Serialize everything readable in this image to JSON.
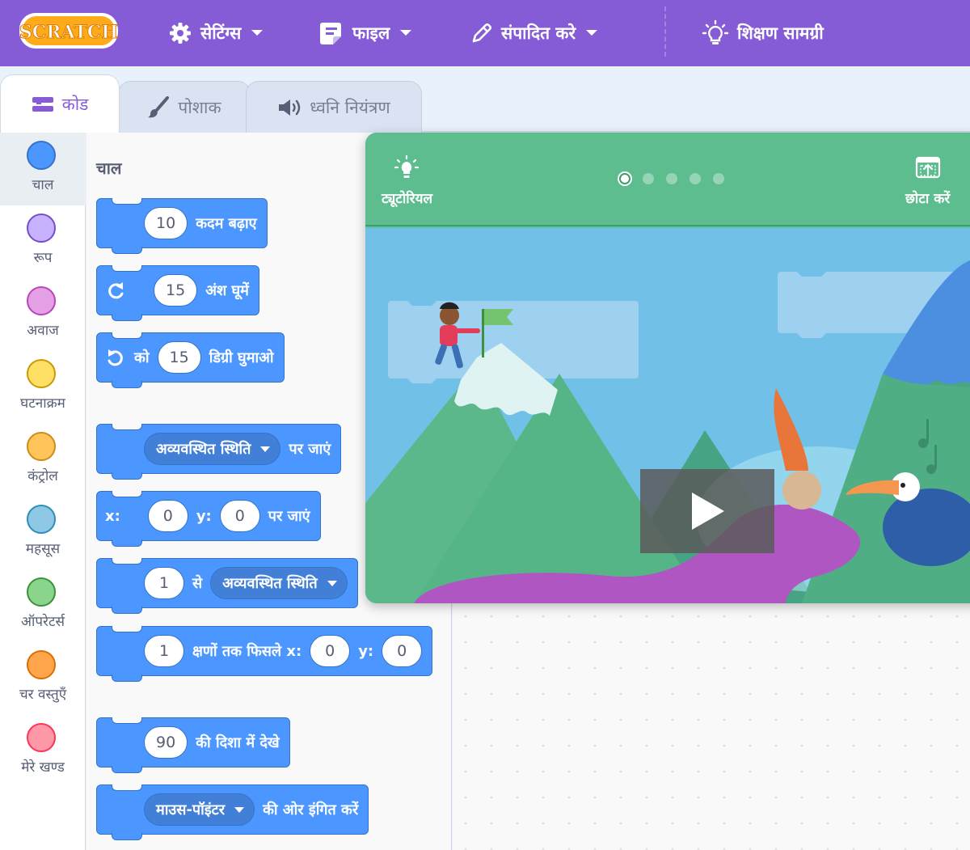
{
  "menubar": {
    "logo_text": "SCRATCH",
    "settings_label": "सेटिंग्स",
    "file_label": "फाइल",
    "edit_label": "संपादित करे",
    "tutorials_label": "शिक्षण सामग्री"
  },
  "tabs": [
    {
      "label": "कोड",
      "icon": "code-icon",
      "active": true
    },
    {
      "label": "पोशाक",
      "icon": "brush-icon",
      "active": false
    },
    {
      "label": "ध्वनि नियंत्रण",
      "icon": "speaker-icon",
      "active": false
    }
  ],
  "categories": [
    {
      "label": "चाल",
      "color": "#4c97ff",
      "border": "#3373cc",
      "selected": true
    },
    {
      "label": "रूप",
      "color": "#9966ff",
      "border": "#774dcb",
      "selected": false
    },
    {
      "label": "अवाज",
      "color": "#cf63cf",
      "border": "#bd42bd",
      "selected": false
    },
    {
      "label": "घटनाक्रम",
      "color": "#ffd500",
      "border": "#cc9900",
      "selected": false
    },
    {
      "label": "कंट्रोल",
      "color": "#ffab19",
      "border": "#cf8b17",
      "selected": false
    },
    {
      "label": "महसूस",
      "color": "#5cb1d6",
      "border": "#2e8eb8",
      "selected": false
    },
    {
      "label": "ऑपरेटर्स",
      "color": "#59c059",
      "border": "#389438",
      "selected": false
    },
    {
      "label": "चर वस्तुएँ",
      "color": "#ff8c1a",
      "border": "#db6e00",
      "selected": false
    },
    {
      "label": "मेरे खण्ड",
      "color": "#ff6680",
      "border": "#ff3355",
      "selected": false
    }
  ],
  "palette": {
    "heading": "चाल",
    "blocks": {
      "move": {
        "value": "10",
        "text": "कदम बढ़ाए"
      },
      "turn_right": {
        "value": "15",
        "text": "अंश घूमें"
      },
      "turn_left": {
        "prefix": "को",
        "value": "15",
        "text": "डिग्री घुमाओ"
      },
      "goto": {
        "dropdown": "अव्यवस्थित स्थिति",
        "text": "पर जाएं"
      },
      "goto_xy": {
        "x_label": "x:",
        "x": "0",
        "y_label": "y:",
        "y": "0",
        "text": "पर जाएं"
      },
      "glide_to": {
        "value": "1",
        "text": "से",
        "dropdown": "अव्यवस्थित स्थिति"
      },
      "glide_xy": {
        "value": "1",
        "text": "क्षणों तक फिसले x:",
        "x": "0",
        "y_label": "y:",
        "y": "0"
      },
      "point_dir": {
        "value": "90",
        "text": "की दिशा में देखे"
      },
      "point_towards": {
        "dropdown": "माउस-पॉइंटर",
        "text": "की ओर इंगित करें"
      }
    }
  },
  "tutorial": {
    "tutorial_label": "ट्यूटोरियल",
    "shrink_label": "छोटा करें",
    "page_dots": 5,
    "current_page": 1
  },
  "colors": {
    "menubar": "#855cd6",
    "motion": "#4c97ff",
    "tutorial_header": "#5dbd8f"
  }
}
